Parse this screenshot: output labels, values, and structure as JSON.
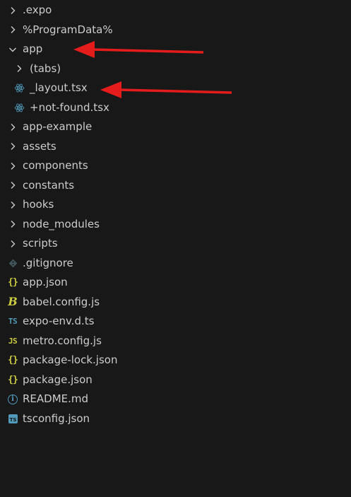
{
  "explorer": {
    "items": [
      {
        "label": ".expo",
        "kind": "folder",
        "expanded": false
      },
      {
        "label": "%ProgramData%",
        "kind": "folder",
        "expanded": false
      },
      {
        "label": "app",
        "kind": "folder",
        "expanded": true
      },
      {
        "label": "(tabs)",
        "kind": "folder",
        "expanded": false
      },
      {
        "label": "_layout.tsx",
        "kind": "file",
        "icon": "react-icon"
      },
      {
        "label": "+not-found.tsx",
        "kind": "file",
        "icon": "react-icon"
      },
      {
        "label": "app-example",
        "kind": "folder",
        "expanded": false
      },
      {
        "label": "assets",
        "kind": "folder",
        "expanded": false
      },
      {
        "label": "components",
        "kind": "folder",
        "expanded": false
      },
      {
        "label": "constants",
        "kind": "folder",
        "expanded": false
      },
      {
        "label": "hooks",
        "kind": "folder",
        "expanded": false
      },
      {
        "label": "node_modules",
        "kind": "folder",
        "expanded": false
      },
      {
        "label": "scripts",
        "kind": "folder",
        "expanded": false
      },
      {
        "label": ".gitignore",
        "kind": "file",
        "icon": "git-icon"
      },
      {
        "label": "app.json",
        "kind": "file",
        "icon": "json-icon",
        "icon_text": "{}"
      },
      {
        "label": "babel.config.js",
        "kind": "file",
        "icon": "babel-icon",
        "icon_text": "B"
      },
      {
        "label": "expo-env.d.ts",
        "kind": "file",
        "icon": "typescript-icon",
        "icon_text": "TS"
      },
      {
        "label": "metro.config.js",
        "kind": "file",
        "icon": "javascript-icon",
        "icon_text": "JS"
      },
      {
        "label": "package-lock.json",
        "kind": "file",
        "icon": "json-icon",
        "icon_text": "{}"
      },
      {
        "label": "package.json",
        "kind": "file",
        "icon": "json-icon",
        "icon_text": "{}"
      },
      {
        "label": "README.md",
        "kind": "file",
        "icon": "info-icon",
        "icon_text": "i"
      },
      {
        "label": "tsconfig.json",
        "kind": "file",
        "icon": "tsconfig-icon",
        "icon_text": "TS"
      }
    ]
  },
  "colors": {
    "background": "#181818",
    "text": "#cccccc",
    "chevron": "#cccccc",
    "react": "#519aba",
    "json": "#cbcb41",
    "typescript": "#519aba",
    "git": "#41535b",
    "annotation_arrow": "#e51c1c"
  }
}
